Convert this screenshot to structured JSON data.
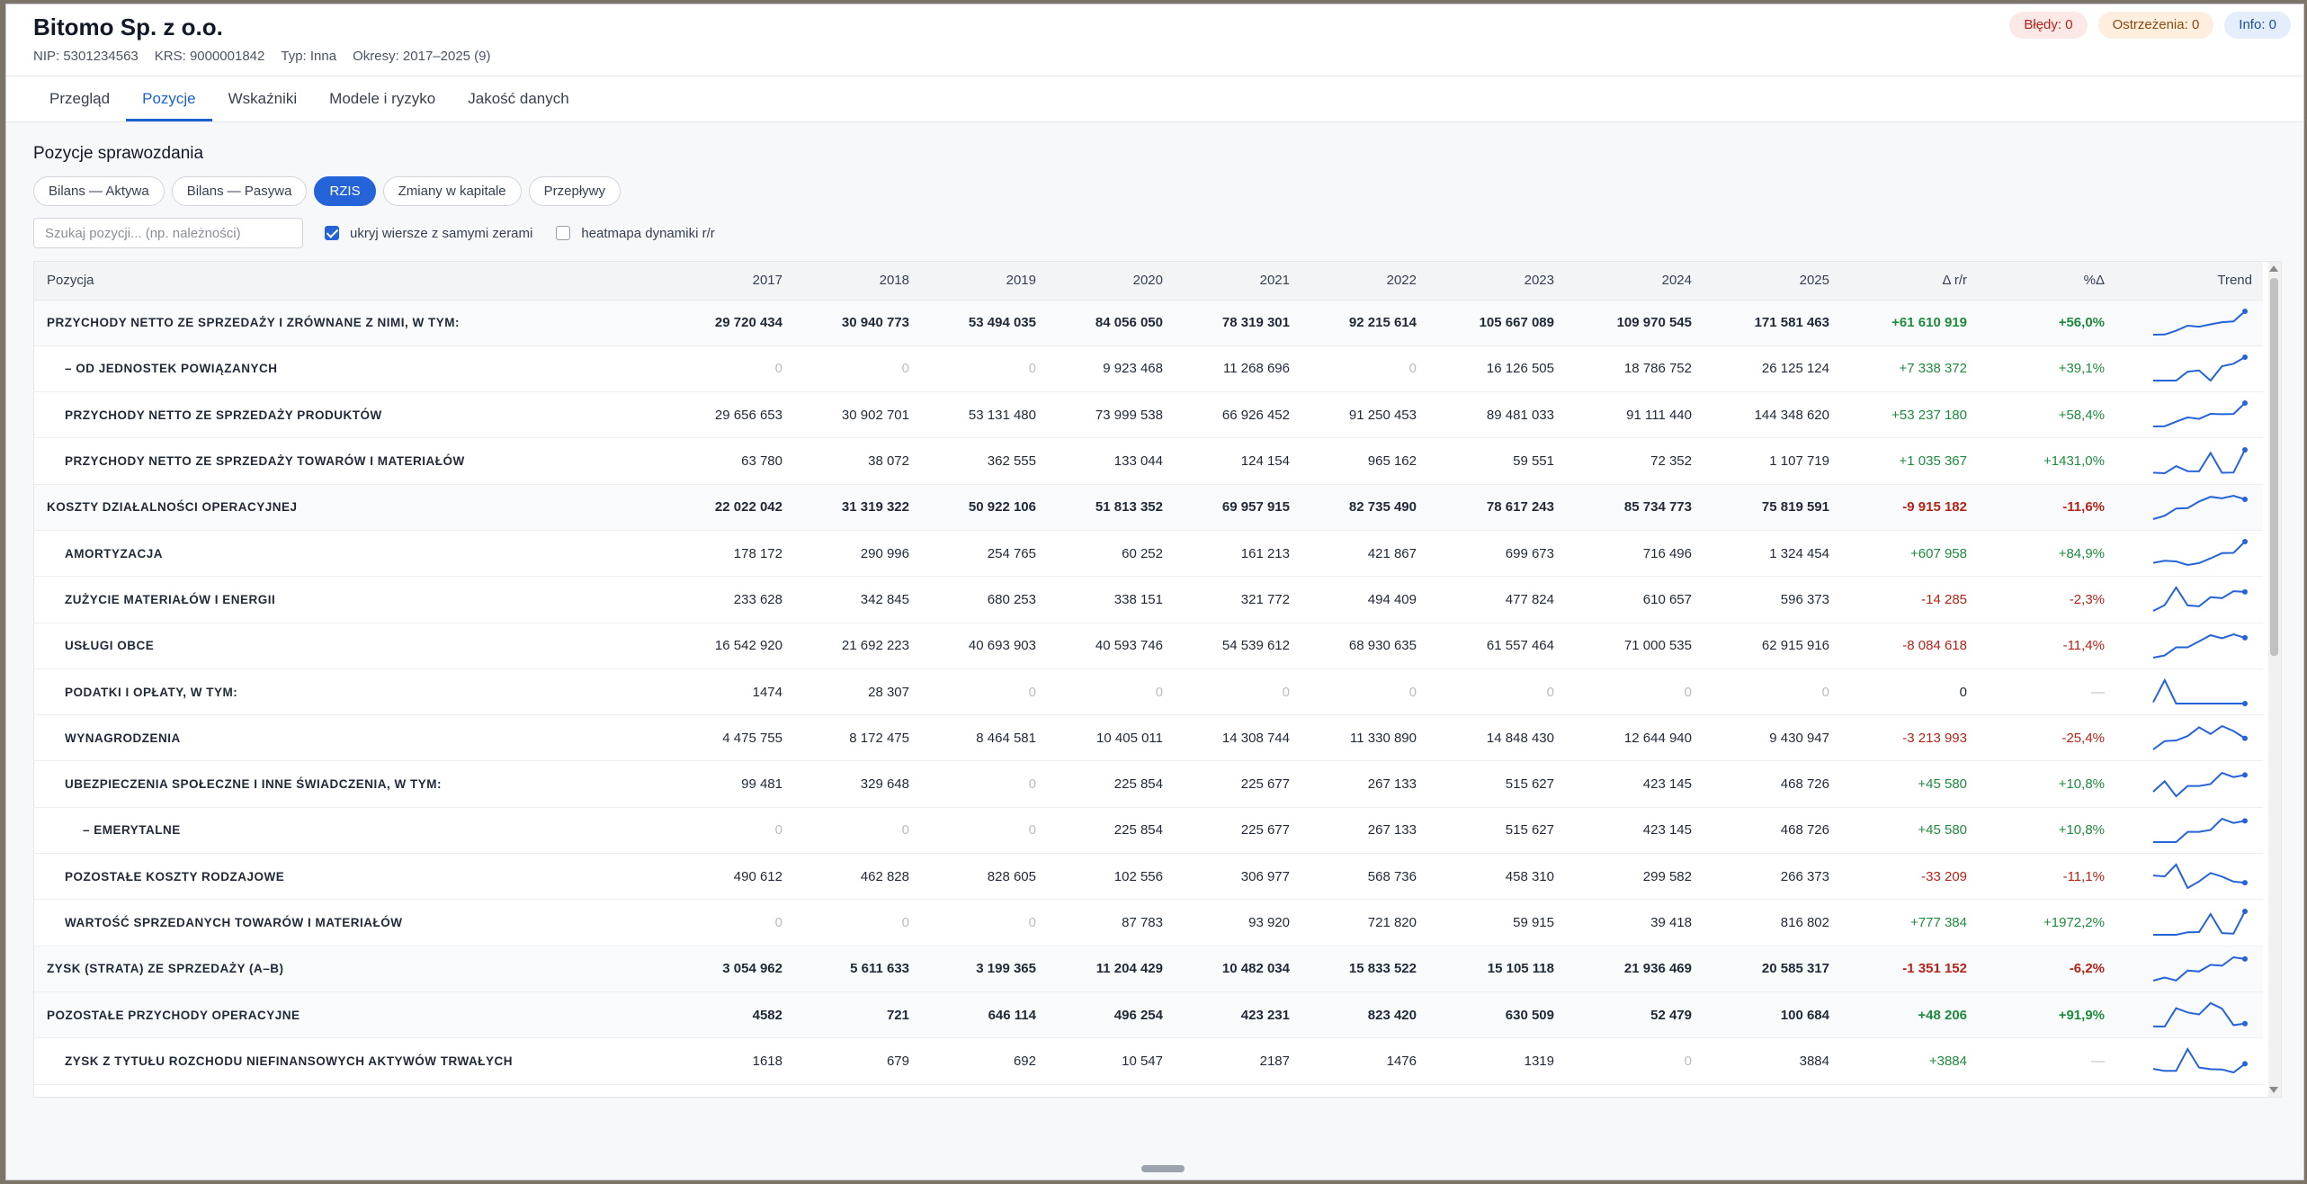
{
  "company": {
    "name": "Bitomo Sp. z o.o.",
    "nip": "NIP: 5301234563",
    "krs": "KRS: 9000001842",
    "type": "Typ: Inna",
    "periods": "Okresy: 2017–2025 (9)"
  },
  "badges": {
    "errors": "Błędy: 0",
    "warnings": "Ostrzeżenia: 0",
    "info": "Info: 0"
  },
  "tabs": [
    "Przegląd",
    "Pozycje",
    "Wskaźniki",
    "Modele i ryzyko",
    "Jakość danych"
  ],
  "active_tab": "Pozycje",
  "section_title": "Pozycje sprawozdania",
  "statement_tabs": [
    "Bilans — Aktywa",
    "Bilans — Pasywa",
    "RZIS",
    "Zmiany w kapitale",
    "Przepływy"
  ],
  "active_statement": "RZIS",
  "search": {
    "placeholder": "Szukaj pozycji... (np. należności)",
    "value": ""
  },
  "filters": {
    "hide_zero_label": "ukryj wiersze z samymi zerami",
    "hide_zero_checked": true,
    "heatmap_label": "heatmapa dynamiki r/r",
    "heatmap_checked": false
  },
  "columns": [
    "Pozycja",
    "2017",
    "2018",
    "2019",
    "2020",
    "2021",
    "2022",
    "2023",
    "2024",
    "2025",
    "Δ r/r",
    "%Δ",
    "Trend"
  ],
  "colors": {
    "accent": "#2563d9",
    "positive": "#1e8a3e",
    "negative": "#b42318",
    "trend": "#2563d9"
  },
  "rows": [
    {
      "label": "PRZYCHODY NETTO ZE SPRZEDAŻY I ZRÓWNANE Z NIMI, W TYM:",
      "level": 0,
      "bold": true,
      "values": [
        29720434,
        30940773,
        53494035,
        84056050,
        78319301,
        92215614,
        105667089,
        109970545,
        171581463
      ],
      "display": [
        "29 720 434",
        "30 940 773",
        "53 494 035",
        "84 056 050",
        "78 319 301",
        "92 215 614",
        "105 667 089",
        "109 970 545",
        "171 581 463"
      ],
      "delta": "+61 610 919",
      "pct": "+56,0%",
      "sign": "pos"
    },
    {
      "label": "– OD JEDNOSTEK POWIĄZANYCH",
      "level": 1,
      "bold": false,
      "values": [
        0,
        0,
        0,
        9923468,
        11268696,
        0,
        16126505,
        18786752,
        26125124
      ],
      "display": [
        "0",
        "0",
        "0",
        "9 923 468",
        "11 268 696",
        "0",
        "16 126 505",
        "18 786 752",
        "26 125 124"
      ],
      "delta": "+7 338 372",
      "pct": "+39,1%",
      "sign": "pos"
    },
    {
      "label": "PRZYCHODY NETTO ZE SPRZEDAŻY PRODUKTÓW",
      "level": 1,
      "bold": false,
      "values": [
        29656653,
        30902701,
        53131480,
        73999538,
        66926452,
        91250453,
        89481033,
        91111440,
        144348620
      ],
      "display": [
        "29 656 653",
        "30 902 701",
        "53 131 480",
        "73 999 538",
        "66 926 452",
        "91 250 453",
        "89 481 033",
        "91 111 440",
        "144 348 620"
      ],
      "delta": "+53 237 180",
      "pct": "+58,4%",
      "sign": "pos"
    },
    {
      "label": "PRZYCHODY NETTO ZE SPRZEDAŻY TOWARÓW I MATERIAŁÓW",
      "level": 1,
      "bold": false,
      "values": [
        63780,
        38072,
        362555,
        133044,
        124154,
        965162,
        59551,
        72352,
        1107719
      ],
      "display": [
        "63 780",
        "38 072",
        "362 555",
        "133 044",
        "124 154",
        "965 162",
        "59 551",
        "72 352",
        "1 107 719"
      ],
      "delta": "+1 035 367",
      "pct": "+1431,0%",
      "sign": "pos"
    },
    {
      "label": "KOSZTY DZIAŁALNOŚCI OPERACYJNEJ",
      "level": 0,
      "bold": true,
      "values": [
        22022042,
        31319322,
        50922106,
        51813352,
        69957915,
        82735490,
        78617243,
        85734773,
        75819591
      ],
      "display": [
        "22 022 042",
        "31 319 322",
        "50 922 106",
        "51 813 352",
        "69 957 915",
        "82 735 490",
        "78 617 243",
        "85 734 773",
        "75 819 591"
      ],
      "delta": "-9 915 182",
      "pct": "-11,6%",
      "sign": "neg"
    },
    {
      "label": "AMORTYZACJA",
      "level": 1,
      "bold": false,
      "values": [
        178172,
        290996,
        254765,
        60252,
        161213,
        421867,
        699673,
        716496,
        1324454
      ],
      "display": [
        "178 172",
        "290 996",
        "254 765",
        "60 252",
        "161 213",
        "421 867",
        "699 673",
        "716 496",
        "1 324 454"
      ],
      "delta": "+607 958",
      "pct": "+84,9%",
      "sign": "pos"
    },
    {
      "label": "ZUŻYCIE MATERIAŁÓW I ENERGII",
      "level": 1,
      "bold": false,
      "values": [
        233628,
        342845,
        680253,
        338151,
        321772,
        494409,
        477824,
        610657,
        596373
      ],
      "display": [
        "233 628",
        "342 845",
        "680 253",
        "338 151",
        "321 772",
        "494 409",
        "477 824",
        "610 657",
        "596 373"
      ],
      "delta": "-14 285",
      "pct": "-2,3%",
      "sign": "neg"
    },
    {
      "label": "USŁUGI OBCE",
      "level": 1,
      "bold": false,
      "values": [
        16542920,
        21692223,
        40693903,
        40593746,
        54539612,
        68930635,
        61557464,
        71000535,
        62915916
      ],
      "display": [
        "16 542 920",
        "21 692 223",
        "40 693 903",
        "40 593 746",
        "54 539 612",
        "68 930 635",
        "61 557 464",
        "71 000 535",
        "62 915 916"
      ],
      "delta": "-8 084 618",
      "pct": "-11,4%",
      "sign": "neg"
    },
    {
      "label": "PODATKI I OPŁATY, W TYM:",
      "level": 1,
      "bold": false,
      "values": [
        1474,
        28307,
        0,
        0,
        0,
        0,
        0,
        0,
        0
      ],
      "display": [
        "1474",
        "28 307",
        "0",
        "0",
        "0",
        "0",
        "0",
        "0",
        "0"
      ],
      "delta": "0",
      "pct": "—",
      "sign": "neu"
    },
    {
      "label": "WYNAGRODZENIA",
      "level": 1,
      "bold": false,
      "values": [
        4475755,
        8172475,
        8464581,
        10405011,
        14308744,
        11330890,
        14848430,
        12644940,
        9430947
      ],
      "display": [
        "4 475 755",
        "8 172 475",
        "8 464 581",
        "10 405 011",
        "14 308 744",
        "11 330 890",
        "14 848 430",
        "12 644 940",
        "9 430 947"
      ],
      "delta": "-3 213 993",
      "pct": "-25,4%",
      "sign": "neg"
    },
    {
      "label": "UBEZPIECZENIA SPOŁECZNE I INNE ŚWIADCZENIA, W TYM:",
      "level": 1,
      "bold": false,
      "values": [
        99481,
        329648,
        0,
        225854,
        225677,
        267133,
        515627,
        423145,
        468726
      ],
      "display": [
        "99 481",
        "329 648",
        "0",
        "225 854",
        "225 677",
        "267 133",
        "515 627",
        "423 145",
        "468 726"
      ],
      "delta": "+45 580",
      "pct": "+10,8%",
      "sign": "pos"
    },
    {
      "label": "– EMERYTALNE",
      "level": 2,
      "bold": false,
      "values": [
        0,
        0,
        0,
        225854,
        225677,
        267133,
        515627,
        423145,
        468726
      ],
      "display": [
        "0",
        "0",
        "0",
        "225 854",
        "225 677",
        "267 133",
        "515 627",
        "423 145",
        "468 726"
      ],
      "delta": "+45 580",
      "pct": "+10,8%",
      "sign": "pos"
    },
    {
      "label": "POZOSTAŁE KOSZTY RODZAJOWE",
      "level": 1,
      "bold": false,
      "values": [
        490612,
        462828,
        828605,
        102556,
        306977,
        568736,
        458310,
        299582,
        266373
      ],
      "display": [
        "490 612",
        "462 828",
        "828 605",
        "102 556",
        "306 977",
        "568 736",
        "458 310",
        "299 582",
        "266 373"
      ],
      "delta": "-33 209",
      "pct": "-11,1%",
      "sign": "neg"
    },
    {
      "label": "WARTOŚĆ SPRZEDANYCH TOWARÓW I MATERIAŁÓW",
      "level": 1,
      "bold": false,
      "values": [
        0,
        0,
        0,
        87783,
        93920,
        721820,
        59915,
        39418,
        816802
      ],
      "display": [
        "0",
        "0",
        "0",
        "87 783",
        "93 920",
        "721 820",
        "59 915",
        "39 418",
        "816 802"
      ],
      "delta": "+777 384",
      "pct": "+1972,2%",
      "sign": "pos"
    },
    {
      "label": "ZYSK (STRATA) ZE SPRZEDAŻY (A–B)",
      "level": 0,
      "bold": true,
      "values": [
        3054962,
        5611633,
        3199365,
        11204429,
        10482034,
        15833522,
        15105118,
        21936469,
        20585317
      ],
      "display": [
        "3 054 962",
        "5 611 633",
        "3 199 365",
        "11 204 429",
        "10 482 034",
        "15 833 522",
        "15 105 118",
        "21 936 469",
        "20 585 317"
      ],
      "delta": "-1 351 152",
      "pct": "-6,2%",
      "sign": "neg"
    },
    {
      "label": "POZOSTAŁE PRZYCHODY OPERACYJNE",
      "level": 0,
      "bold": true,
      "values": [
        4582,
        721,
        646114,
        496254,
        423231,
        823420,
        630509,
        52479,
        100684
      ],
      "display": [
        "4582",
        "721",
        "646 114",
        "496 254",
        "423 231",
        "823 420",
        "630 509",
        "52 479",
        "100 684"
      ],
      "delta": "+48 206",
      "pct": "+91,9%",
      "sign": "pos"
    },
    {
      "label": "ZYSK Z TYTUŁU ROZCHODU NIEFINANSOWYCH AKTYWÓW TRWAŁYCH",
      "level": 1,
      "bold": false,
      "values": [
        1618,
        679,
        692,
        10547,
        2187,
        1476,
        1319,
        0,
        3884
      ],
      "display": [
        "1618",
        "679",
        "692",
        "10 547",
        "2187",
        "1476",
        "1319",
        "0",
        "3884"
      ],
      "delta": "+3884",
      "pct": "—",
      "sign": "pos"
    }
  ]
}
